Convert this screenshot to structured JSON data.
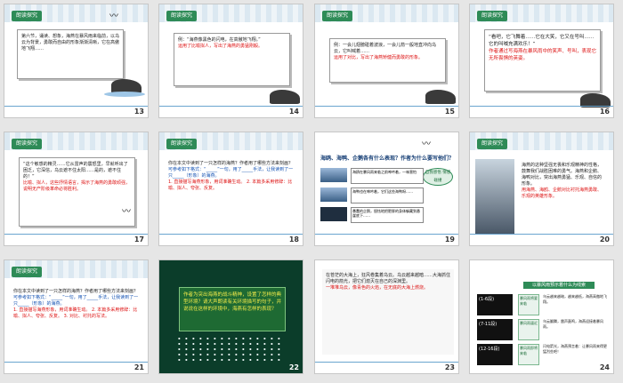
{
  "tag_label": "朗读探究",
  "slides": [
    {
      "number": "13",
      "text": "第六节，诵读、想象，海燕在暴风雨来临前，以乌云为背景，勇敢而自由的形象渐渐清晰，它在高傲地飞翔……"
    },
    {
      "number": "14",
      "text": "例：“海燕像黑色的闪电，在高傲地飞翔。”",
      "red": "运用了比喻拟人，写出了海燕的勇猛刚毅。"
    },
    {
      "number": "15",
      "text": "例：一会儿翅膀碰着波浪，一会儿箭一般地直冲向乌云，它叫喊着……",
      "red": "运用了对比，写出了海燕矫健而勇敢的形象。"
    },
    {
      "number": "16",
      "text": "“看吧，它飞舞着……它在大笑，它又在号叫……它的叫喊充满欢乐！”",
      "red": "作者通过写海燕在暴风雨中的笑声、号叫，表现它无所畏惧的英姿。"
    },
    {
      "number": "17",
      "text": "“这个敏感的精灵……它从雷声的震怒里，早就听出了困乏，它深信，乌云遮不住太阳……是的，遮不住的！”",
      "red": "比喻、拟人，这些抒情语言，揭示了海燕的勇敢顽强，说明无产阶级革命必将胜利。"
    },
    {
      "number": "18",
      "text": "你在本文中读到了一只怎样的海燕？作者用了哪些方法来刻画？",
      "blue": "可参考如下格式：“_____”一句，用了_____手法，让我读到了一只_____（形象）的海燕。",
      "red": "1. 直接描写海燕形象，用词准确生动。 2. 本篇多采用修辞：比喻、拟人、夸张、反复。"
    },
    {
      "number": "19",
      "title": "海鸥、海鸭、企鹅各有什么表现？作者为什么要写他们？",
      "button": "自我感悟 情感碰撞",
      "rows": [
        "海鸥在暴风雨来临之前呻吟着，一味害怕",
        "海鸭也在呻吟着，它们这些海鸭呀……",
        "愚蠢的企鹅，胆怯地把肥胖的身体躲藏到悬崖底下……"
      ]
    },
    {
      "number": "20",
      "text": "海燕的这种坚强无畏和乐观精神的性格，鼓舞我们战胜困难的勇气。海燕和企鹅、海鸭对比，突出海燕勇猛、乐观、自信的形象。",
      "red": "用海燕、海鸥、企鹅对比衬托海燕勇敢、乐观的英雄形象。"
    },
    {
      "number": "21",
      "text": "你在本文中读到了一只怎样的海燕？作者用了哪些方法来刻画？",
      "blue": "可参考如下格式：“_____”一句，用了_____手法，让我读到了一只_____（形象）的海燕。",
      "red": "1. 直接描写海燕形象，用词准确生动。 2. 本篇多采用修辞：比喻、拟人、夸张、反复。 3. 对比、衬托的写法。"
    },
    {
      "number": "22",
      "text": "作者为突出海燕的战斗精神，设置了怎样的典型环境？请大声朗读有关环境描写的句子，并说说在这样的环境中，海燕有怎样的表现？"
    },
    {
      "number": "23",
      "text": "在苍茫的大海上，狂风卷集着乌云。乌云越来越暗……大海抓住闪电的箭光，把它们熄灭在自己的深渊里。",
      "red": "一堆堆乌云，像青色的火焰，在无底的大海上燃烧。"
    },
    {
      "number": "24",
      "title": "以暴风雨预示着什么为线索",
      "items": [
        {
          "time": "(1-6段)",
          "label": "暴风雨将要来临",
          "text": "乌云越来越暗，越来越低，海燕高傲地飞翔。"
        },
        {
          "time": "(7-11段)",
          "label": "暴风雨逼近",
          "text": "乌云翻腾，雷声轰鸣，海燕迎接着暴风雨。"
        },
        {
          "time": "(12-16段)",
          "label": "暴风雨即将来临",
          "text": "闪电箭光，海燕预言着：让暴风雨来得更猛烈些吧！"
        }
      ]
    }
  ]
}
